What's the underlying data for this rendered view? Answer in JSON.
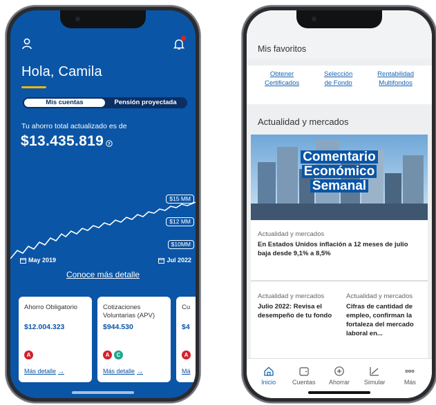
{
  "left": {
    "greeting": "Hola, Camila",
    "toggle": {
      "active": "Mis cuentas",
      "inactive": "Pensión proyectada"
    },
    "savings_label": "Tu ahorro total actualizado es de",
    "savings_amount": "$13.435.819",
    "chart_tags": [
      "$15 MM",
      "$12 MM",
      "$10MM"
    ],
    "date_start": "May 2019",
    "date_end": "Jul 2022",
    "detail_link": "Conoce más detalle",
    "cards": [
      {
        "name": "Ahorro Obligatorio",
        "amount": "$12.004.323",
        "badges": [
          "A"
        ],
        "more": "Más detalle"
      },
      {
        "name": "Cotizaciones Voluntarias (APV)",
        "amount": "$944.530",
        "badges": [
          "A",
          "C"
        ],
        "more": "Más detalle"
      },
      {
        "name": "Cu",
        "amount": "$4",
        "badges": [
          "A"
        ],
        "more": "Má"
      }
    ]
  },
  "right": {
    "favorites_title": "Mis favoritos",
    "favorites": [
      {
        "line1": "Obtener",
        "line2": "Certificados"
      },
      {
        "line1": "Selección",
        "line2": "de Fondo"
      },
      {
        "line1": "Rentabilidad",
        "line2": "Multifondos"
      }
    ],
    "news_title": "Actualidad y mercados",
    "hero_lines": [
      "Comentario",
      "Económico",
      "Semanal"
    ],
    "article_main": {
      "category": "Actualidad y mercados",
      "headline": "En Estados Unidos inflación a 12 meses de julio baja desde 9,1% a 8,5%"
    },
    "articles": [
      {
        "category": "Actualidad y mercados",
        "headline": "Julio 2022: Revisa el desempeño de tu fondo"
      },
      {
        "category": "Actualidad y mercados",
        "headline": "Cifras de cantidad de empleo, confirman la fortaleza del mercado laboral en..."
      }
    ],
    "tabs": [
      "Inicio",
      "Cuentas",
      "Ahorrar",
      "Simular",
      "Más"
    ]
  },
  "colors": {
    "brand_blue": "#0a55a6",
    "accent_gold": "#f2b705",
    "badge_red": "#d4202c",
    "badge_teal": "#1aa68d"
  }
}
